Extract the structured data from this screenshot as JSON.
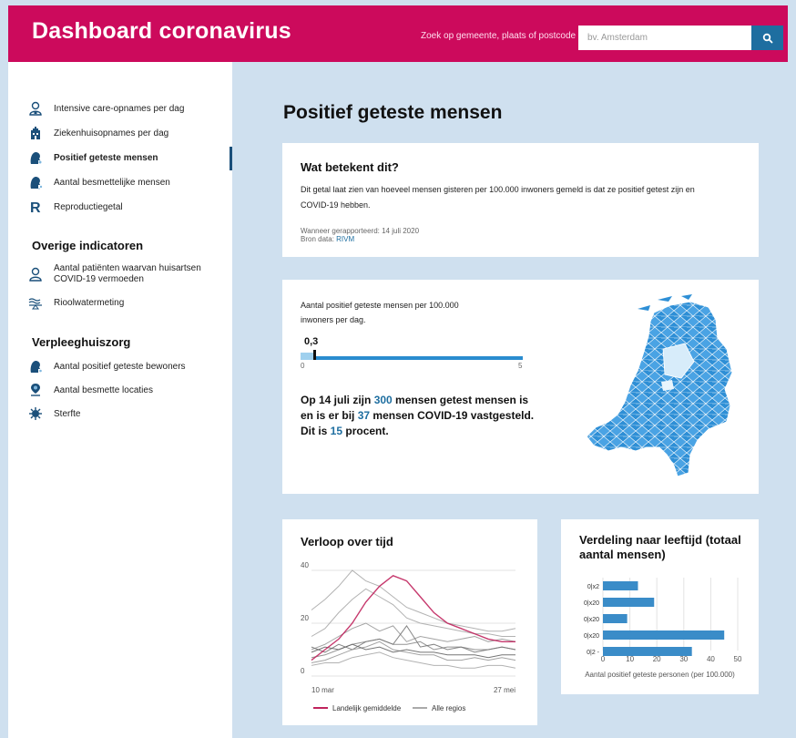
{
  "header": {
    "title": "Dashboard coronavirus",
    "search_label": "Zoek op gemeente, plaats of postcode",
    "search_placeholder": "bv. Amsterdam",
    "brand_color": "#cc0a5c"
  },
  "sidebar": {
    "items": [
      {
        "label": "Intensive care-opnames per dag",
        "icon": "doctor-icon"
      },
      {
        "label": "Ziekenhuisopnames per dag",
        "icon": "hospital-icon"
      },
      {
        "label": "Positief geteste mensen",
        "icon": "head-virus-icon",
        "active": true
      },
      {
        "label": "Aantal besmettelijke mensen",
        "icon": "head-virus-icon"
      },
      {
        "label": "Reproductiegetal",
        "icon": "r-icon"
      }
    ],
    "other_heading": "Overige indicatoren",
    "other_items": [
      {
        "label_line1": "Aantal patiënten waarvan huisartsen",
        "label_line2": "COVID-19 vermoeden",
        "icon": "doctor-icon"
      },
      {
        "label": "Rioolwatermeting",
        "icon": "sewer-icon"
      }
    ],
    "nursing_heading": "Verpleeghuiszorg",
    "nursing_items": [
      {
        "label": "Aantal positief geteste bewoners",
        "icon": "head-virus-icon"
      },
      {
        "label": "Aantal besmette locaties",
        "icon": "location-icon"
      },
      {
        "label": "Sterfte",
        "icon": "virus-icon"
      }
    ]
  },
  "main": {
    "title": "Positief geteste mensen",
    "info": {
      "title": "Wat betekent dit?",
      "text": "Dit getal laat zien van hoeveel mensen gisteren per 100.000 inwoners gemeld is dat ze positief getest zijn en COVID-19 hebben.",
      "reported": "Wanneer gerapporteerd: 14 juli 2020",
      "source_label": "Bron data:",
      "source_link": "RIVM"
    },
    "metric": {
      "label": "Aantal positief geteste mensen per 100.000 inwoners per dag.",
      "value": "0,3",
      "value_number": 0.3,
      "min": "0",
      "max": "5",
      "summary_1": "Op 14 juli zijn ",
      "tested": "300",
      "summary_2": " mensen getest mensen is en is er bij ",
      "positive": "37",
      "summary_3": " mensen COVID-19 vastgesteld. Dit is ",
      "percent": "15",
      "summary_4": " procent."
    },
    "trend": {
      "title": "Verloop over tijd",
      "legend_national": "Landelijk gemiddelde",
      "legend_regions": "Alle regios"
    },
    "age": {
      "title": "Verdeling naar leeftijd (totaal aantal mensen)"
    }
  },
  "chart_data": [
    {
      "type": "line",
      "title": "Verloop over tijd",
      "x_start": "10 mar",
      "x_end": "27 mei",
      "y_ticks": [
        "0",
        "20",
        "40"
      ],
      "ylim": [
        0,
        40
      ],
      "grid": true,
      "legend": "bottom",
      "series": [
        {
          "name": "Landelijk gemiddelde",
          "color": "#c0245d",
          "values": [
            6,
            10,
            14,
            20,
            28,
            34,
            38,
            36,
            30,
            24,
            20,
            18,
            16,
            14,
            13,
            13
          ]
        },
        {
          "name": "Alle regios",
          "color": "#aaaaaa",
          "values": [
            25,
            29,
            34,
            40,
            36,
            34,
            30,
            26,
            24,
            22,
            20,
            19,
            18,
            17,
            17,
            18
          ]
        },
        {
          "name": "Alle regios",
          "color": "#aaaaaa",
          "values": [
            15,
            18,
            24,
            29,
            33,
            30,
            27,
            22,
            20,
            19,
            18,
            17,
            16,
            16,
            15,
            15
          ]
        },
        {
          "name": "Alle regios",
          "color": "#999999",
          "values": [
            10,
            12,
            15,
            18,
            20,
            17,
            19,
            13,
            15,
            14,
            13,
            14,
            15,
            13,
            14,
            13
          ]
        },
        {
          "name": "Alle regios",
          "color": "#888888",
          "values": [
            7,
            8,
            10,
            12,
            13,
            14,
            12,
            12,
            13,
            10,
            11,
            11,
            10,
            10,
            11,
            10
          ]
        },
        {
          "name": "Alle regios",
          "color": "#777777",
          "values": [
            11,
            9,
            12,
            10,
            13,
            14,
            12,
            19,
            11,
            12,
            10,
            11,
            9,
            10,
            11,
            10
          ]
        },
        {
          "name": "Alle regios",
          "color": "#999999",
          "values": [
            5,
            6,
            8,
            10,
            11,
            13,
            10,
            9,
            8,
            8,
            6,
            6,
            7,
            6,
            7,
            6
          ]
        },
        {
          "name": "Alle regios",
          "color": "#666666",
          "values": [
            9,
            11,
            10,
            12,
            10,
            11,
            9,
            10,
            9,
            9,
            8,
            8,
            8,
            7,
            8,
            8
          ]
        },
        {
          "name": "Alle regios",
          "color": "#aaaaaa",
          "values": [
            4,
            5,
            5,
            7,
            8,
            9,
            7,
            6,
            5,
            4,
            4,
            3,
            3,
            4,
            4,
            3
          ]
        }
      ]
    },
    {
      "type": "bar",
      "orientation": "horizontal",
      "title": "Verdeling naar leeftijd (totaal aantal mensen)",
      "xlabel": "Aantal positief geteste personen (per 100.000)",
      "categories": [
        "0-19",
        "20-39",
        "40-59",
        "60-79",
        "80+"
      ],
      "category_labels": [
        "0|x2",
        "0|x20",
        "0|x20",
        "0|x20",
        "0|2 -"
      ],
      "values": [
        13,
        19,
        9,
        45,
        33
      ],
      "x_ticks": [
        "0",
        "10",
        "20",
        "30",
        "40",
        "50"
      ],
      "xlim": [
        0,
        50
      ],
      "color": "#3a8cc8"
    }
  ]
}
